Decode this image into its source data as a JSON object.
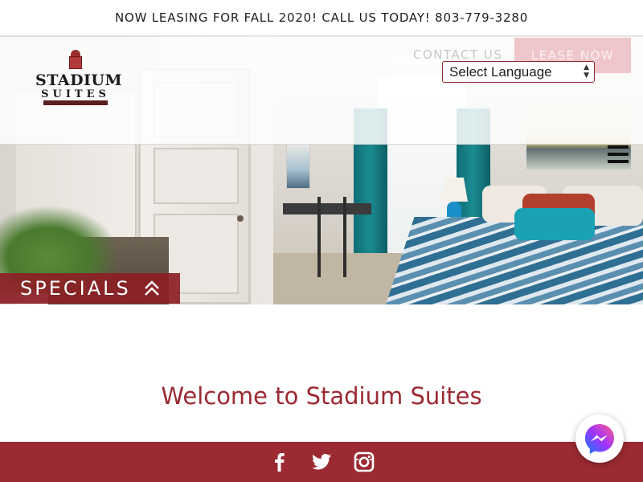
{
  "announcement": {
    "text": "NOW LEASING FOR FALL 2020! CALL US TODAY! 803-779-3280"
  },
  "header": {
    "logo": {
      "line1": "STADIUM",
      "line2": "SUITES"
    },
    "nav": {
      "contact_label": "CONTACT US",
      "lease_label": "LEASE NOW"
    },
    "language_select": {
      "selected": "Select Language"
    },
    "menu_icon": "hamburger-menu-icon"
  },
  "hero": {
    "specials_label": "SPECIALS",
    "specials_icon": "double-chevron-up-icon"
  },
  "main": {
    "welcome_heading": "Welcome to Stadium Suites"
  },
  "footer": {
    "social": [
      "facebook-icon",
      "twitter-icon",
      "instagram-icon"
    ]
  },
  "chat_widget": {
    "icon": "messenger-icon"
  },
  "colors": {
    "brand": "#9b2a32",
    "lease_button": "#efc6c9",
    "text_dark": "#1e1e1e"
  }
}
